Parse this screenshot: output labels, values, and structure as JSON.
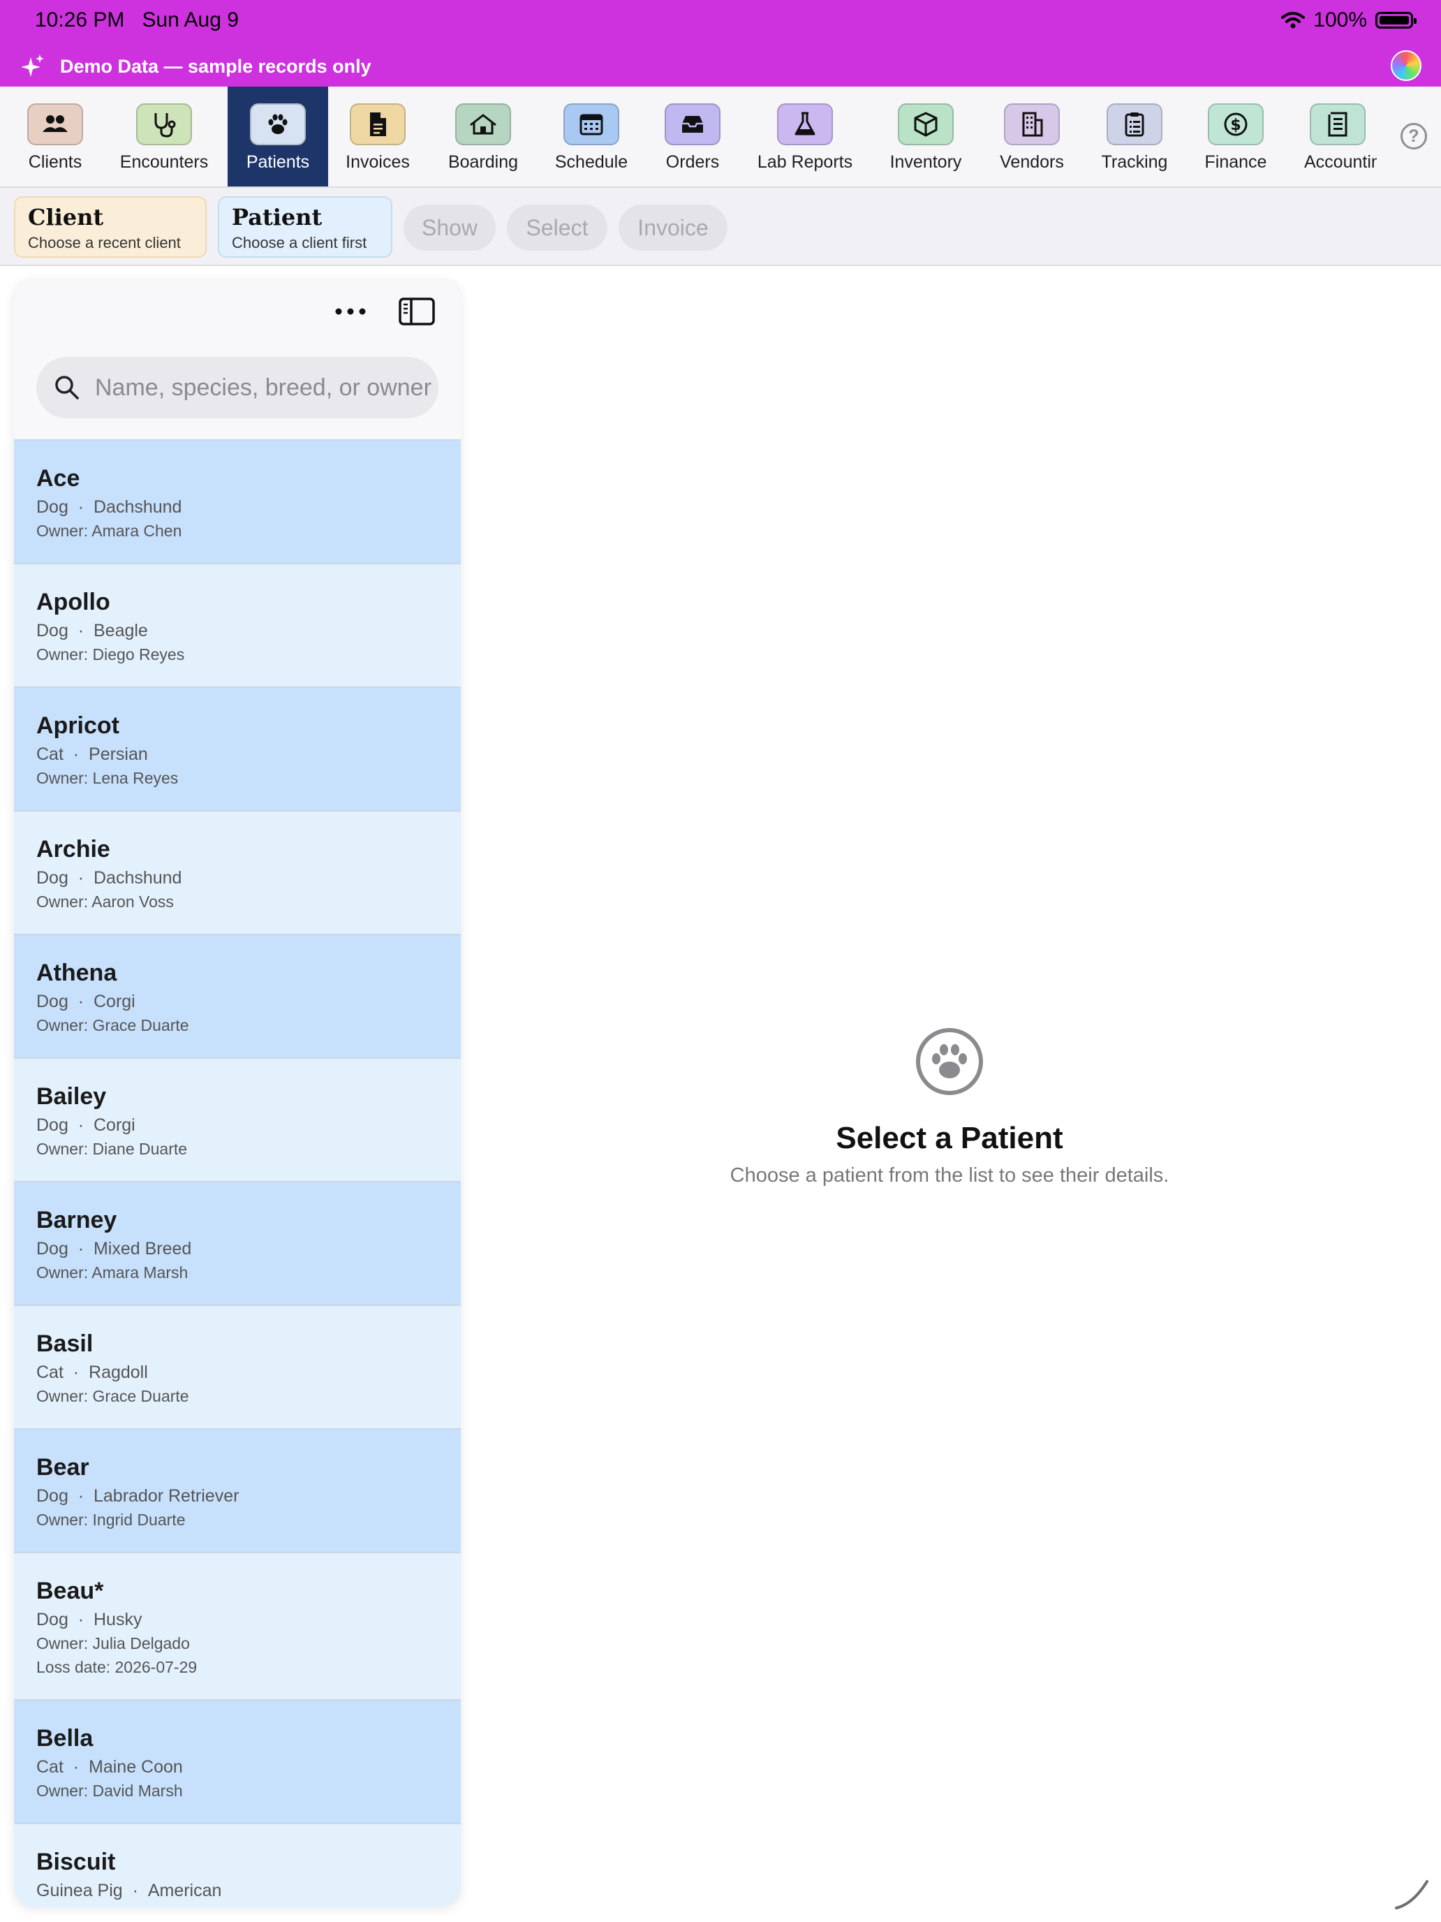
{
  "status": {
    "time": "10:26 PM",
    "date": "Sun Aug 9",
    "battery": "100%"
  },
  "banner": {
    "text": "Demo Data — sample records only"
  },
  "colors": {
    "banner_bg": "#cd32de",
    "nav_active_bg": "#1d3568",
    "row_dark": "#c7e0fc",
    "row_light": "#e3f1fd"
  },
  "nav": {
    "items": [
      {
        "label": "Clients",
        "icon": "people-icon",
        "color": "#e8cfc4"
      },
      {
        "label": "Encounters",
        "icon": "stethoscope-icon",
        "color": "#cde3b8"
      },
      {
        "label": "Patients",
        "icon": "paw-icon",
        "color": "#d7e3f3",
        "active": true
      },
      {
        "label": "Invoices",
        "icon": "document-icon",
        "color": "#f0d8a4"
      },
      {
        "label": "Boarding",
        "icon": "house-icon",
        "color": "#b7d6c2"
      },
      {
        "label": "Schedule",
        "icon": "calendar-icon",
        "color": "#a9c9f3"
      },
      {
        "label": "Orders",
        "icon": "tray-icon",
        "color": "#c0b8f0"
      },
      {
        "label": "Lab Reports",
        "icon": "flask-icon",
        "color": "#cbb8f0"
      },
      {
        "label": "Inventory",
        "icon": "box-icon",
        "color": "#b9e2c6"
      },
      {
        "label": "Vendors",
        "icon": "building-icon",
        "color": "#d7c8e8"
      },
      {
        "label": "Tracking",
        "icon": "clipboard-icon",
        "color": "#cfd3e8"
      },
      {
        "label": "Finance",
        "icon": "dollar-icon",
        "color": "#bfe6d4"
      },
      {
        "label": "Accountin",
        "icon": "ledger-icon",
        "color": "#bfe3d5"
      }
    ],
    "help": "?"
  },
  "context": {
    "client": {
      "title": "Client",
      "subtitle": "Choose a recent client"
    },
    "patient": {
      "title": "Patient",
      "subtitle": "Choose a client first"
    },
    "actions": [
      "Show",
      "Select",
      "Invoice"
    ]
  },
  "sidebar": {
    "search_placeholder": "Name, species, breed, or owner",
    "patients": [
      {
        "name": "Ace",
        "species": "Dog",
        "breed": "Dachshund",
        "owner": "Owner: Amara Chen"
      },
      {
        "name": "Apollo",
        "species": "Dog",
        "breed": "Beagle",
        "owner": "Owner: Diego Reyes"
      },
      {
        "name": "Apricot",
        "species": "Cat",
        "breed": "Persian",
        "owner": "Owner: Lena Reyes"
      },
      {
        "name": "Archie",
        "species": "Dog",
        "breed": "Dachshund",
        "owner": "Owner: Aaron Voss"
      },
      {
        "name": "Athena",
        "species": "Dog",
        "breed": "Corgi",
        "owner": "Owner: Grace Duarte"
      },
      {
        "name": "Bailey",
        "species": "Dog",
        "breed": "Corgi",
        "owner": "Owner: Diane Duarte"
      },
      {
        "name": "Barney",
        "species": "Dog",
        "breed": "Mixed Breed",
        "owner": "Owner: Amara Marsh"
      },
      {
        "name": "Basil",
        "species": "Cat",
        "breed": "Ragdoll",
        "owner": "Owner: Grace Duarte"
      },
      {
        "name": "Bear",
        "species": "Dog",
        "breed": "Labrador Retriever",
        "owner": "Owner: Ingrid Duarte"
      },
      {
        "name": "Beau*",
        "species": "Dog",
        "breed": "Husky",
        "owner": "Owner: Julia Delgado",
        "extra": "Loss date: 2026-07-29"
      },
      {
        "name": "Bella",
        "species": "Cat",
        "breed": "Maine Coon",
        "owner": "Owner: David Marsh"
      },
      {
        "name": "Biscuit",
        "species": "Guinea Pig",
        "breed": "American",
        "owner": ""
      }
    ]
  },
  "empty_state": {
    "title": "Select a Patient",
    "subtitle": "Choose a patient from the list to see their details."
  }
}
